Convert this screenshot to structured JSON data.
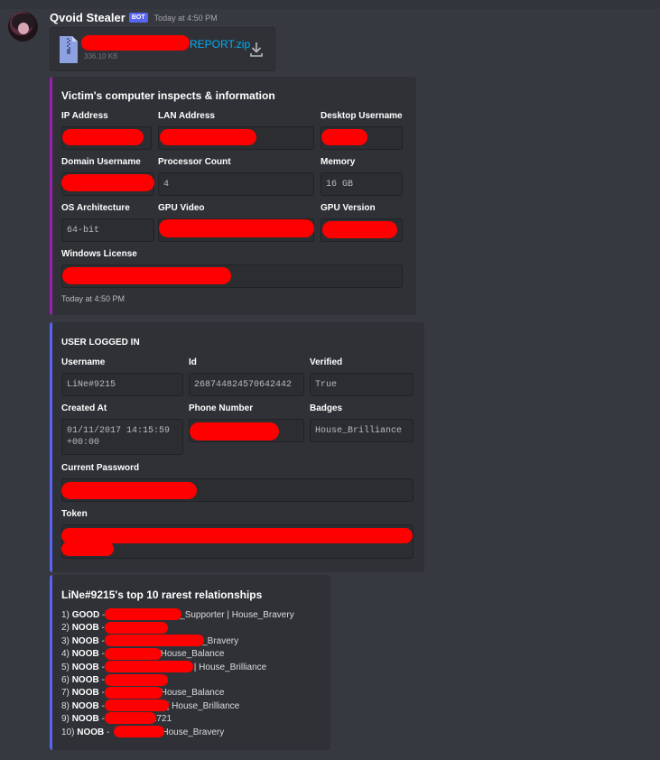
{
  "message": {
    "author": "Qvoid Stealer",
    "bot_tag": "BOT",
    "timestamp": "Today at 4:50 PM"
  },
  "attachment": {
    "file_name_visible": "REPORT.zip",
    "file_size": "336.10 KB",
    "icon": "zip-file-icon",
    "download_icon": "download-icon"
  },
  "embed1": {
    "accent": "#9b1fb0",
    "title": "Victim's computer inspects & information",
    "fields": {
      "ip_label": "IP Address",
      "lan_label": "LAN Address",
      "desktop_label": "Desktop Username",
      "domain_label": "Domain Username",
      "proc_label": "Processor Count",
      "proc_value": "4",
      "mem_label": "Memory",
      "mem_value": "16 GB",
      "arch_label": "OS Architecture",
      "arch_value": "64-bit",
      "gpu_label": "GPU Video",
      "gpuver_label": "GPU Version",
      "license_label": "Windows License"
    },
    "footer": "Today at 4:50 PM"
  },
  "embed2": {
    "accent": "#5865f2",
    "title": "USER LOGGED IN",
    "fields": {
      "username_label": "Username",
      "username_value": "LiNe#9215",
      "id_label": "Id",
      "id_value": "268744824570642442",
      "verified_label": "Verified",
      "verified_value": "True",
      "created_label": "Created At",
      "created_value_line1": "01/11/2017 14:15:59",
      "created_value_line2": "+00:00",
      "phone_label": "Phone Number",
      "badges_label": "Badges",
      "badges_value": "House_Brilliance",
      "password_label": "Current Password",
      "token_label": "Token"
    }
  },
  "embed3": {
    "accent": "#5865f2",
    "title": "LiNe#9215's top 10 rarest relationships",
    "rows": [
      {
        "rank": "1)",
        "grade": "GOOD",
        "sep": " -",
        "suffix": "Early_Supporter | House_Bravery"
      },
      {
        "rank": "2)",
        "grade": "NOOB",
        "sep": " -",
        "suffix": ""
      },
      {
        "rank": "3)",
        "grade": "NOOB",
        "sep": " -",
        "suffix": "| House_Bravery"
      },
      {
        "rank": "4)",
        "grade": "NOOB",
        "sep": " -",
        "suffix": "House_Balance"
      },
      {
        "rank": "5)",
        "grade": "NOOB",
        "sep": " -",
        "suffix": "| House_Brilliance"
      },
      {
        "rank": "6)",
        "grade": "NOOB",
        "sep": " -",
        "suffix": ""
      },
      {
        "rank": "7)",
        "grade": "NOOB",
        "sep": " -",
        "suffix": "House_Balance"
      },
      {
        "rank": "8)",
        "grade": "NOOB",
        "sep": " -",
        "suffix": "| House_Brilliance"
      },
      {
        "rank": "9)",
        "grade": "NOOB",
        "sep": " -",
        "suffix": "1721"
      },
      {
        "rank": "10)",
        "grade": "NOOB",
        "sep": " -",
        "suffix": "House_Bravery"
      }
    ]
  },
  "colors": {
    "background": "#36393f",
    "embed_bg": "#2f3136",
    "redaction": "#ff0000",
    "link": "#00aff4"
  }
}
